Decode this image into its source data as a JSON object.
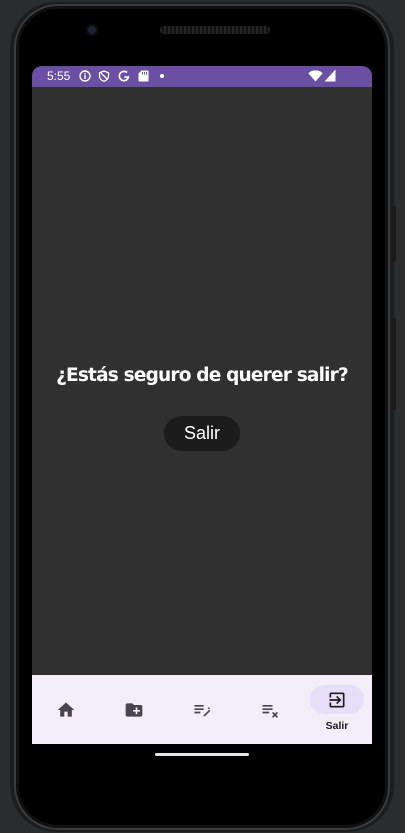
{
  "status_bar": {
    "time": "5:55",
    "icons": [
      "info-icon",
      "shield-icon",
      "google-icon",
      "sd-card-icon",
      "dot-icon",
      "wifi-icon",
      "signal-icon"
    ],
    "color": "#6a4fa3"
  },
  "main": {
    "question": "¿Estás seguro de querer salir?",
    "exit_button_label": "Salir",
    "background": "#303030"
  },
  "bottom_nav": {
    "items": [
      {
        "icon": "home-icon",
        "label": ""
      },
      {
        "icon": "folder-add-icon",
        "label": ""
      },
      {
        "icon": "edit-list-icon",
        "label": ""
      },
      {
        "icon": "delete-list-icon",
        "label": ""
      },
      {
        "icon": "logout-icon",
        "label": "Salir",
        "active": true
      }
    ],
    "background": "#f3edf7",
    "active_indicator": "#e8def8"
  }
}
